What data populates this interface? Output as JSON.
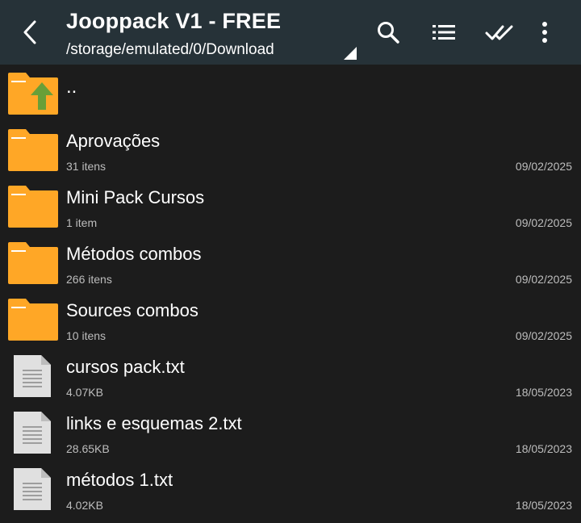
{
  "header": {
    "title": "Jooppack V1 - FREE",
    "path": "/storage/emulated/0/Download",
    "icons": {
      "back": "chevron-left-icon",
      "search": "search-icon",
      "view": "list-view-icon",
      "select": "double-check-icon",
      "menu": "more-vert-icon"
    }
  },
  "colors": {
    "appbar": "#263238",
    "background": "#1c1c1c",
    "folder": "#ffa726",
    "up_arrow": "#689f38",
    "file_icon": "#e0e0e0"
  },
  "list": {
    "parent": {
      "label": ".."
    },
    "items": [
      {
        "type": "folder",
        "name": "Aprovações",
        "meta": "31 itens",
        "date": "09/02/2025"
      },
      {
        "type": "folder",
        "name": "Mini Pack Cursos",
        "meta": "1 item",
        "date": "09/02/2025"
      },
      {
        "type": "folder",
        "name": "Métodos combos",
        "meta": "266 itens",
        "date": "09/02/2025"
      },
      {
        "type": "folder",
        "name": "Sources combos",
        "meta": "10 itens",
        "date": "09/02/2025"
      },
      {
        "type": "file",
        "name": "cursos pack.txt",
        "meta": "4.07KB",
        "date": "18/05/2023"
      },
      {
        "type": "file",
        "name": "links e esquemas 2.txt",
        "meta": "28.65KB",
        "date": "18/05/2023"
      },
      {
        "type": "file",
        "name": "métodos 1.txt",
        "meta": "4.02KB",
        "date": "18/05/2023"
      }
    ]
  }
}
